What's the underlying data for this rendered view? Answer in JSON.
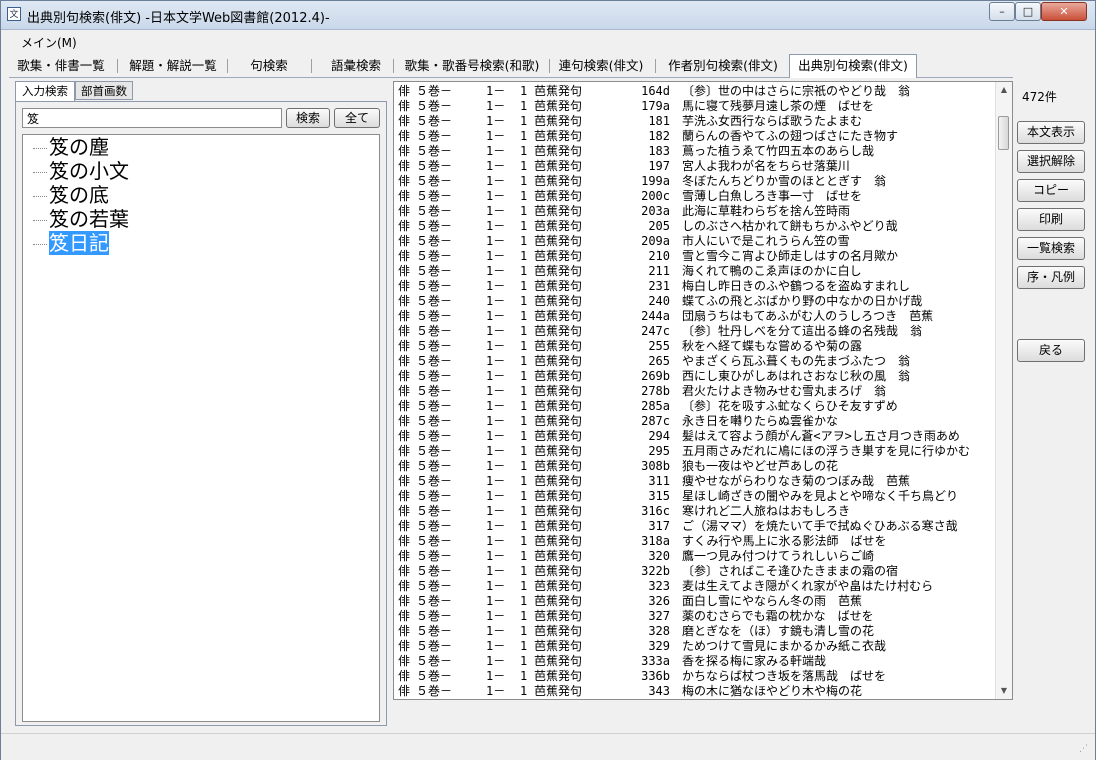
{
  "window": {
    "title": "出典別句検索(俳文) -日本文学Web図書館(2012.4)-",
    "icon": "app-window-icon",
    "btn_min": "–",
    "btn_max": "□",
    "btn_close": "✕"
  },
  "menu": {
    "main": "メイン(M)"
  },
  "tabs": [
    "歌集・俳書一覧",
    "解題・解説一覧",
    "句検索",
    "語彙検索",
    "歌集・歌番号検索(和歌)",
    "連句検索(俳文)",
    "作者別句検索(俳文)",
    "出典別句検索(俳文)"
  ],
  "left": {
    "subtabs": [
      "入力検索",
      "部首画数"
    ],
    "search_value": "笈",
    "search_button": "検索",
    "all_button": "全て",
    "tree": [
      "笈の塵",
      "笈の小文",
      "笈の底",
      "笈の若葉",
      "笈日記"
    ]
  },
  "rows": [
    {
      "c1": "俳",
      "c2": "５巻－",
      "c3": "1－",
      "c4": "1",
      "c5": "芭蕉発句",
      "c6": "164d",
      "c7": "〔参〕世の中はさらに宗祇のやどり哉　翁"
    },
    {
      "c1": "俳",
      "c2": "５巻－",
      "c3": "1－",
      "c4": "1",
      "c5": "芭蕉発句",
      "c6": "179a",
      "c7": "馬に寝て残夢月遠し茶の煙　ばせを"
    },
    {
      "c1": "俳",
      "c2": "５巻－",
      "c3": "1－",
      "c4": "1",
      "c5": "芭蕉発句",
      "c6": "181",
      "c7": "芋洗ふ女西行ならば歌うたよまむ"
    },
    {
      "c1": "俳",
      "c2": "５巻－",
      "c3": "1－",
      "c4": "1",
      "c5": "芭蕉発句",
      "c6": "182",
      "c7": "蘭らんの香やてふの翅つばさにたき物す"
    },
    {
      "c1": "俳",
      "c2": "５巻－",
      "c3": "1－",
      "c4": "1",
      "c5": "芭蕉発句",
      "c6": "183",
      "c7": "蔦った植うゑて竹四五本のあらし哉"
    },
    {
      "c1": "俳",
      "c2": "５巻－",
      "c3": "1－",
      "c4": "1",
      "c5": "芭蕉発句",
      "c6": "197",
      "c7": "宮人よ我わが名をちらせ落葉川"
    },
    {
      "c1": "俳",
      "c2": "５巻－",
      "c3": "1－",
      "c4": "1",
      "c5": "芭蕉発句",
      "c6": "199a",
      "c7": "冬ぼたんちどりか雪のほととぎす　翁"
    },
    {
      "c1": "俳",
      "c2": "５巻－",
      "c3": "1－",
      "c4": "1",
      "c5": "芭蕉発句",
      "c6": "200c",
      "c7": "雪薄し白魚しろき事一寸　ばせを"
    },
    {
      "c1": "俳",
      "c2": "５巻－",
      "c3": "1－",
      "c4": "1",
      "c5": "芭蕉発句",
      "c6": "203a",
      "c7": "此海に草鞋わらぢを捨ん笠時雨"
    },
    {
      "c1": "俳",
      "c2": "５巻－",
      "c3": "1－",
      "c4": "1",
      "c5": "芭蕉発句",
      "c6": "205",
      "c7": "しのぶさへ枯かれて餅もちかふやどり哉"
    },
    {
      "c1": "俳",
      "c2": "５巻－",
      "c3": "1－",
      "c4": "1",
      "c5": "芭蕉発句",
      "c6": "209a",
      "c7": "市人にいで是これうらん笠の雪"
    },
    {
      "c1": "俳",
      "c2": "５巻－",
      "c3": "1－",
      "c4": "1",
      "c5": "芭蕉発句",
      "c6": "210",
      "c7": "雪と雪今こ宵よひ師走しはすの名月歟か"
    },
    {
      "c1": "俳",
      "c2": "５巻－",
      "c3": "1－",
      "c4": "1",
      "c5": "芭蕉発句",
      "c6": "211",
      "c7": "海くれて鴨のこゑ声ほのかに白し"
    },
    {
      "c1": "俳",
      "c2": "５巻－",
      "c3": "1－",
      "c4": "1",
      "c5": "芭蕉発句",
      "c6": "231",
      "c7": "梅白し昨日きのふや鶴つるを盗ぬすまれし"
    },
    {
      "c1": "俳",
      "c2": "５巻－",
      "c3": "1－",
      "c4": "1",
      "c5": "芭蕉発句",
      "c6": "240",
      "c7": "蝶てふの飛とぶばかり野の中なかの日かげ哉"
    },
    {
      "c1": "俳",
      "c2": "５巻－",
      "c3": "1－",
      "c4": "1",
      "c5": "芭蕉発句",
      "c6": "244a",
      "c7": "団扇うちはもてあふがむ人のうしろつき　芭蕉"
    },
    {
      "c1": "俳",
      "c2": "５巻－",
      "c3": "1－",
      "c4": "1",
      "c5": "芭蕉発句",
      "c6": "247c",
      "c7": "〔参〕牡丹しべを分て這出る蜂の名残哉　翁"
    },
    {
      "c1": "俳",
      "c2": "５巻－",
      "c3": "1－",
      "c4": "1",
      "c5": "芭蕉発句",
      "c6": "255",
      "c7": "秋をへ経て蝶もな嘗めるや菊の露"
    },
    {
      "c1": "俳",
      "c2": "５巻－",
      "c3": "1－",
      "c4": "1",
      "c5": "芭蕉発句",
      "c6": "265",
      "c7": "やまざくら瓦ふ葺くもの先まづふたつ　翁"
    },
    {
      "c1": "俳",
      "c2": "５巻－",
      "c3": "1－",
      "c4": "1",
      "c5": "芭蕉発句",
      "c6": "269b",
      "c7": "西にし東ひがしあはれさおなじ秋の風　翁"
    },
    {
      "c1": "俳",
      "c2": "５巻－",
      "c3": "1－",
      "c4": "1",
      "c5": "芭蕉発句",
      "c6": "278b",
      "c7": "君火たけよき物みせむ雪丸まろげ　翁"
    },
    {
      "c1": "俳",
      "c2": "５巻－",
      "c3": "1－",
      "c4": "1",
      "c5": "芭蕉発句",
      "c6": "285a",
      "c7": "〔参〕花を吸すふ虻なくらひそ友すずめ"
    },
    {
      "c1": "俳",
      "c2": "５巻－",
      "c3": "1－",
      "c4": "1",
      "c5": "芭蕉発句",
      "c6": "287c",
      "c7": "永き日を囀りたらぬ雲雀かな"
    },
    {
      "c1": "俳",
      "c2": "５巻－",
      "c3": "1－",
      "c4": "1",
      "c5": "芭蕉発句",
      "c6": "294",
      "c7": "髪はえて容よう顔がん蒼<アヲ>し五さ月つき雨あめ"
    },
    {
      "c1": "俳",
      "c2": "５巻－",
      "c3": "1－",
      "c4": "1",
      "c5": "芭蕉発句",
      "c6": "295",
      "c7": "五月雨さみだれに鳰にほの浮うき巣すを見に行ゆかむ"
    },
    {
      "c1": "俳",
      "c2": "５巻－",
      "c3": "1－",
      "c4": "1",
      "c5": "芭蕉発句",
      "c6": "308b",
      "c7": "狼も一夜はやどせ芦あしの花"
    },
    {
      "c1": "俳",
      "c2": "５巻－",
      "c3": "1－",
      "c4": "1",
      "c5": "芭蕉発句",
      "c6": "311",
      "c7": "痩やせながらわりなき菊のつぼみ哉　芭蕉"
    },
    {
      "c1": "俳",
      "c2": "５巻－",
      "c3": "1－",
      "c4": "1",
      "c5": "芭蕉発句",
      "c6": "315",
      "c7": "星ほし崎ざきの闇やみを見よとや啼なく千ち鳥どり"
    },
    {
      "c1": "俳",
      "c2": "５巻－",
      "c3": "1－",
      "c4": "1",
      "c5": "芭蕉発句",
      "c6": "316c",
      "c7": "寒けれど二人旅ねはおもしろき"
    },
    {
      "c1": "俳",
      "c2": "５巻－",
      "c3": "1－",
      "c4": "1",
      "c5": "芭蕉発句",
      "c6": "317",
      "c7": "ご（湯ママ）を焼たいて手で拭ぬぐひあぶる寒さ哉"
    },
    {
      "c1": "俳",
      "c2": "５巻－",
      "c3": "1－",
      "c4": "1",
      "c5": "芭蕉発句",
      "c6": "318a",
      "c7": "すくみ行や馬上に氷る影法師　ばせを"
    },
    {
      "c1": "俳",
      "c2": "５巻－",
      "c3": "1－",
      "c4": "1",
      "c5": "芭蕉発句",
      "c6": "320",
      "c7": "鷹一つ見み付つけてうれしいらご崎"
    },
    {
      "c1": "俳",
      "c2": "５巻－",
      "c3": "1－",
      "c4": "1",
      "c5": "芭蕉発句",
      "c6": "322b",
      "c7": "〔参〕さればこそ逢ひたきままの霜の宿"
    },
    {
      "c1": "俳",
      "c2": "５巻－",
      "c3": "1－",
      "c4": "1",
      "c5": "芭蕉発句",
      "c6": "323",
      "c7": "麦は生えてよき隠がくれ家がや畠はたけ村むら"
    },
    {
      "c1": "俳",
      "c2": "５巻－",
      "c3": "1－",
      "c4": "1",
      "c5": "芭蕉発句",
      "c6": "326",
      "c7": "面白し雪にやならん冬の雨　芭蕉"
    },
    {
      "c1": "俳",
      "c2": "５巻－",
      "c3": "1－",
      "c4": "1",
      "c5": "芭蕉発句",
      "c6": "327",
      "c7": "薬のむさらでも霜の枕かな　ばせを"
    },
    {
      "c1": "俳",
      "c2": "５巻－",
      "c3": "1－",
      "c4": "1",
      "c5": "芭蕉発句",
      "c6": "328",
      "c7": "磨とぎなを（ほ）す鏡も清し雪の花"
    },
    {
      "c1": "俳",
      "c2": "５巻－",
      "c3": "1－",
      "c4": "1",
      "c5": "芭蕉発句",
      "c6": "329",
      "c7": "ためつけて雪見にまかるかみ紙こ衣哉"
    },
    {
      "c1": "俳",
      "c2": "５巻－",
      "c3": "1－",
      "c4": "1",
      "c5": "芭蕉発句",
      "c6": "333a",
      "c7": "香を探る梅に家みる軒端哉"
    },
    {
      "c1": "俳",
      "c2": "５巻－",
      "c3": "1－",
      "c4": "1",
      "c5": "芭蕉発句",
      "c6": "336b",
      "c7": "かちならば杖つき坂を落馬哉　ばせを"
    },
    {
      "c1": "俳",
      "c2": "５巻－",
      "c3": "1－",
      "c4": "1",
      "c5": "芭蕉発句",
      "c6": "343",
      "c7": "梅の木に猶なほやどり木や梅の花"
    }
  ],
  "right": {
    "count": "472件",
    "buttons": [
      "本文表示",
      "選択解除",
      "コピー",
      "印刷",
      "一覧検索",
      "序・凡例",
      "戻る"
    ]
  }
}
